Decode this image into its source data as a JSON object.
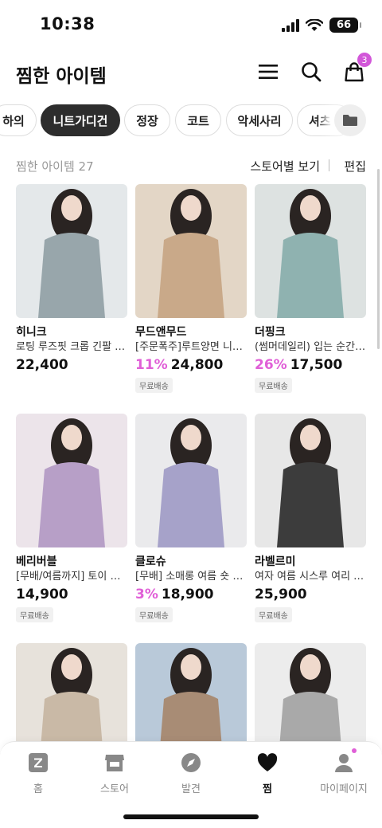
{
  "status": {
    "time": "10:38",
    "battery": "66"
  },
  "header": {
    "title": "찜한 아이템",
    "cart_count": "3"
  },
  "chips": [
    {
      "label": "하의",
      "active": false
    },
    {
      "label": "니트가디건",
      "active": true
    },
    {
      "label": "정장",
      "active": false
    },
    {
      "label": "코트",
      "active": false
    },
    {
      "label": "악세사리",
      "active": false
    },
    {
      "label": "셔츠",
      "active": false
    }
  ],
  "list": {
    "count_label": "찜한 아이템 27",
    "store_view": "스토어별 보기",
    "edit": "편집"
  },
  "products": [
    {
      "brand": "히니크",
      "name": "로팅 루즈핏 크롭 긴팔 가디건",
      "discount": "",
      "price": "22,400",
      "shipping": "",
      "colors": [
        "#e4e8ea",
        "#98a6ab"
      ]
    },
    {
      "brand": "무드앤무드",
      "name": "[주문폭주]루트양면 니트 가디건",
      "discount": "11%",
      "price": "24,800",
      "shipping": "무료배송",
      "colors": [
        "#e3d6c6",
        "#c9a989"
      ]
    },
    {
      "brand": "더핑크",
      "name": "(썸머데일리) 입는 순간 가디건",
      "discount": "26%",
      "price": "17,500",
      "shipping": "무료배송",
      "colors": [
        "#dde2e1",
        "#8fb2b0"
      ]
    },
    {
      "brand": "베리버블",
      "name": "[무배/여름까지] 토이 니트 가디건",
      "discount": "",
      "price": "14,900",
      "shipping": "무료배송",
      "colors": [
        "#ece4ea",
        "#b79fc7"
      ]
    },
    {
      "brand": "클로슈",
      "name": "[무배] 소매롱 여름 숏 가디건",
      "discount": "3%",
      "price": "18,900",
      "shipping": "무료배송",
      "colors": [
        "#eaeaec",
        "#a6a2c9"
      ]
    },
    {
      "brand": "라벨르미",
      "name": "여자 여름 시스루 여리 가디건",
      "discount": "",
      "price": "25,900",
      "shipping": "무료배송",
      "colors": [
        "#e7e7e7",
        "#3c3c3c"
      ]
    },
    {
      "brand": "",
      "name": "",
      "discount": "",
      "price": "",
      "shipping": "",
      "colors": [
        "#e7e2db",
        "#c9b9a6"
      ]
    },
    {
      "brand": "",
      "name": "",
      "discount": "",
      "price": "",
      "shipping": "",
      "colors": [
        "#b9c9d9",
        "#a88c75"
      ]
    },
    {
      "brand": "",
      "name": "",
      "discount": "",
      "price": "",
      "shipping": "",
      "colors": [
        "#ececec",
        "#a9a9a9"
      ]
    }
  ],
  "nav": [
    {
      "label": "홈",
      "icon": "home-z-icon",
      "active": false
    },
    {
      "label": "스토어",
      "icon": "store-icon",
      "active": false
    },
    {
      "label": "발견",
      "icon": "compass-icon",
      "active": false
    },
    {
      "label": "찜",
      "icon": "heart-icon",
      "active": true
    },
    {
      "label": "마이페이지",
      "icon": "person-icon",
      "active": false
    }
  ],
  "colors": {
    "accent": "#e05fd7",
    "badge": "#d257d9",
    "chip_active": "#2d2d2d"
  }
}
